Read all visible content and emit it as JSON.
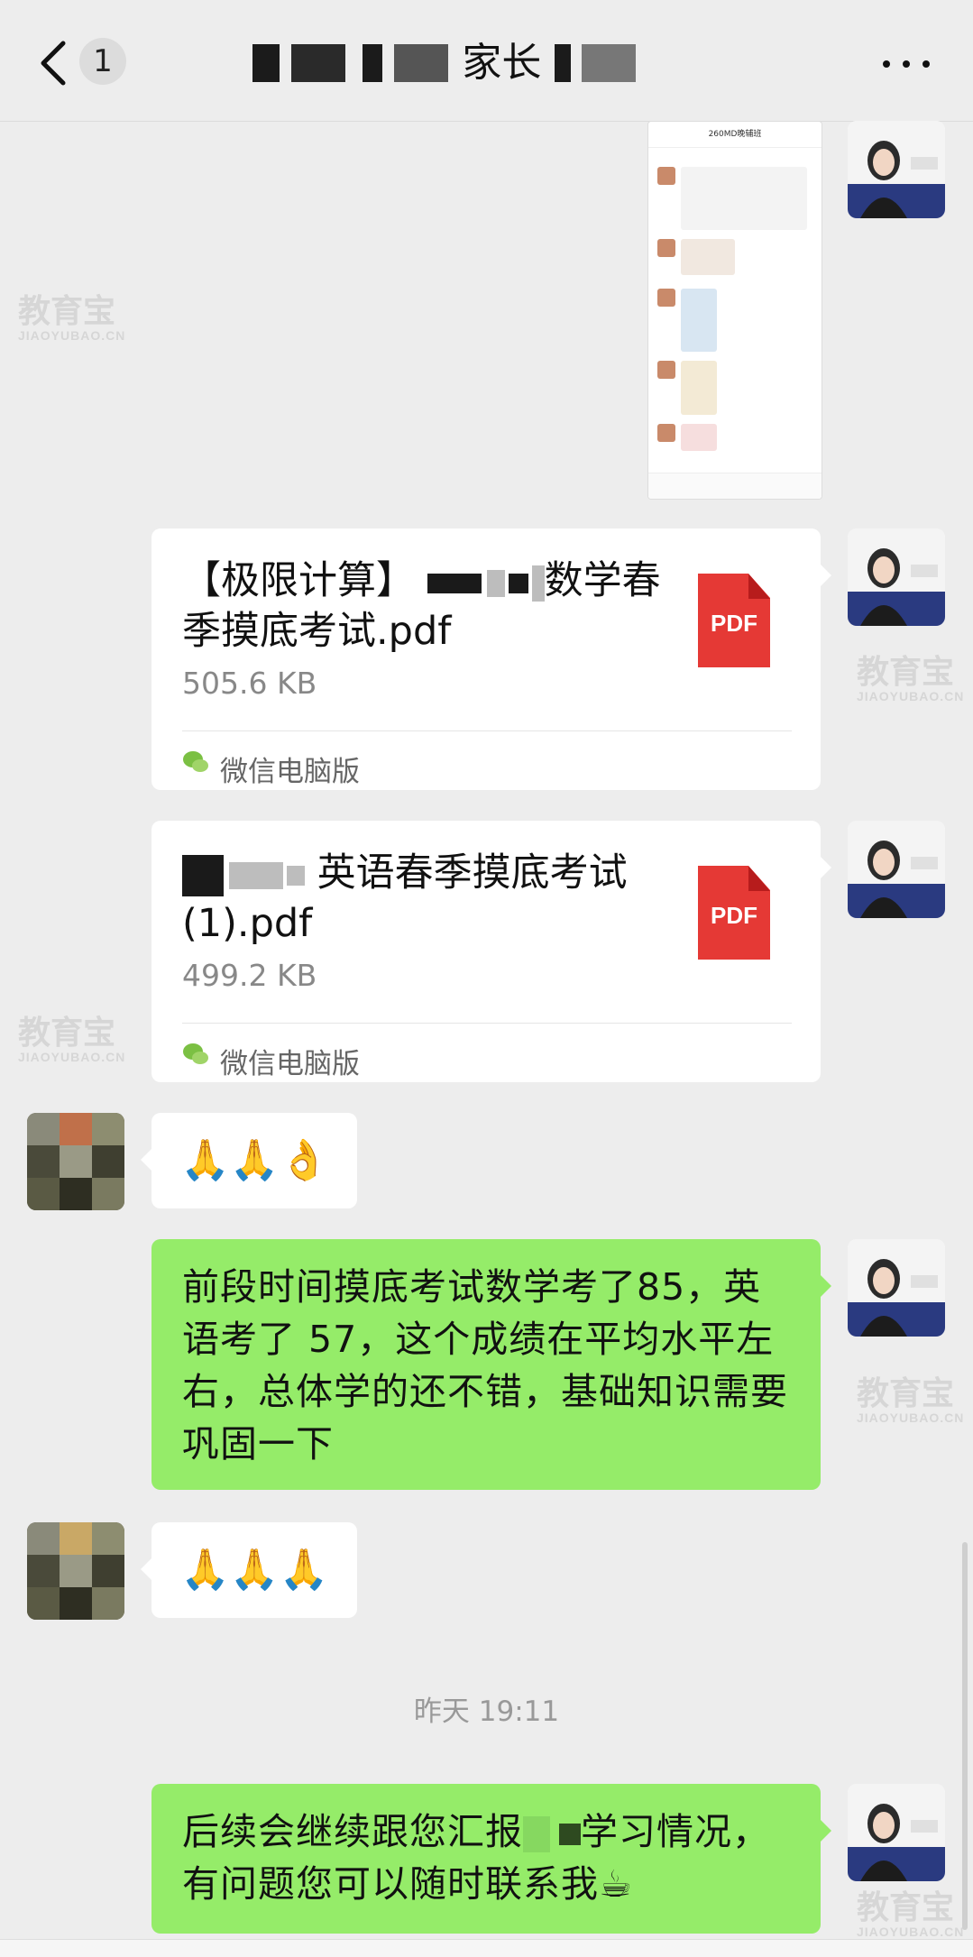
{
  "header": {
    "back_badge": "1",
    "title_fragment_1": "家长"
  },
  "messages": {
    "file1": {
      "name_line1_a": "【极限计算】",
      "name_line1_b": "数学春",
      "name_line2": "季摸底考试.pdf",
      "size": "505.6 KB",
      "source": "微信电脑版",
      "icon_label": "PDF"
    },
    "file2": {
      "name_line1": "英语春季摸底考试",
      "name_line2": "(1).pdf",
      "size": "499.2 KB",
      "source": "微信电脑版",
      "icon_label": "PDF"
    },
    "reply1": "🙏🙏👌",
    "report_text": "前段时间摸底考试数学考了85，英语考了 57，这个成绩在平均水平左右，总体学的还不错，基础知识需要巩固一下",
    "reply2": "🙏🙏🙏",
    "timestamp": "昨天 19:11",
    "followup_a": "后续会继续跟您汇报",
    "followup_b": "学习情况，有问题您可以随时联系我☕"
  },
  "screenshot_thumb": {
    "title": "260MD晚辅班"
  },
  "watermark": {
    "line1": "教育宝",
    "line2": "JIAOYUBAO.CN"
  },
  "colors": {
    "background": "#ededed",
    "sent_bubble": "#95ec69",
    "received_bubble": "#ffffff",
    "pdf_red": "#e53935"
  }
}
